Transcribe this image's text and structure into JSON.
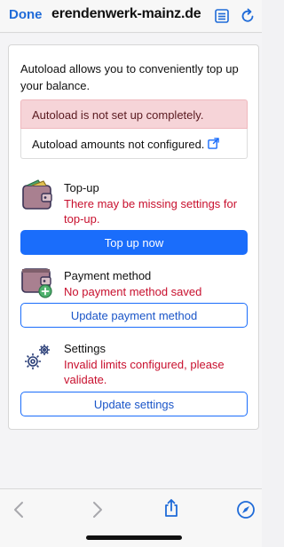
{
  "browser": {
    "done_label": "Done",
    "url": "erendenwerk-mainz.de",
    "icons": {
      "reader": "reader-mode-icon",
      "reload": "reload-icon"
    }
  },
  "autoload": {
    "intro": "Autoload allows you to conveniently top up your balance.",
    "alert_danger": "Autoload is not set up completely.",
    "alert_info": "Autoload amounts not configured.",
    "alert_info_icon": "external-link-icon"
  },
  "sections": {
    "topup": {
      "title": "Top-up",
      "warning": "There may be missing settings for top-up.",
      "button": "Top up now",
      "icon": "wallet-icon"
    },
    "payment": {
      "title": "Payment method",
      "warning": "No payment method saved",
      "button": "Update payment method",
      "icon": "wallet-add-icon"
    },
    "settings": {
      "title": "Settings",
      "warning": "Invalid limits configured, please validate.",
      "button": "Update settings",
      "icon": "gears-icon"
    }
  },
  "toolbar": {
    "icons": [
      "back-icon",
      "forward-icon",
      "share-icon",
      "compass-icon"
    ]
  },
  "colors": {
    "accent": "#1a6dfb",
    "danger_text": "#c8102e",
    "alert_bg": "#f6d4d8"
  }
}
